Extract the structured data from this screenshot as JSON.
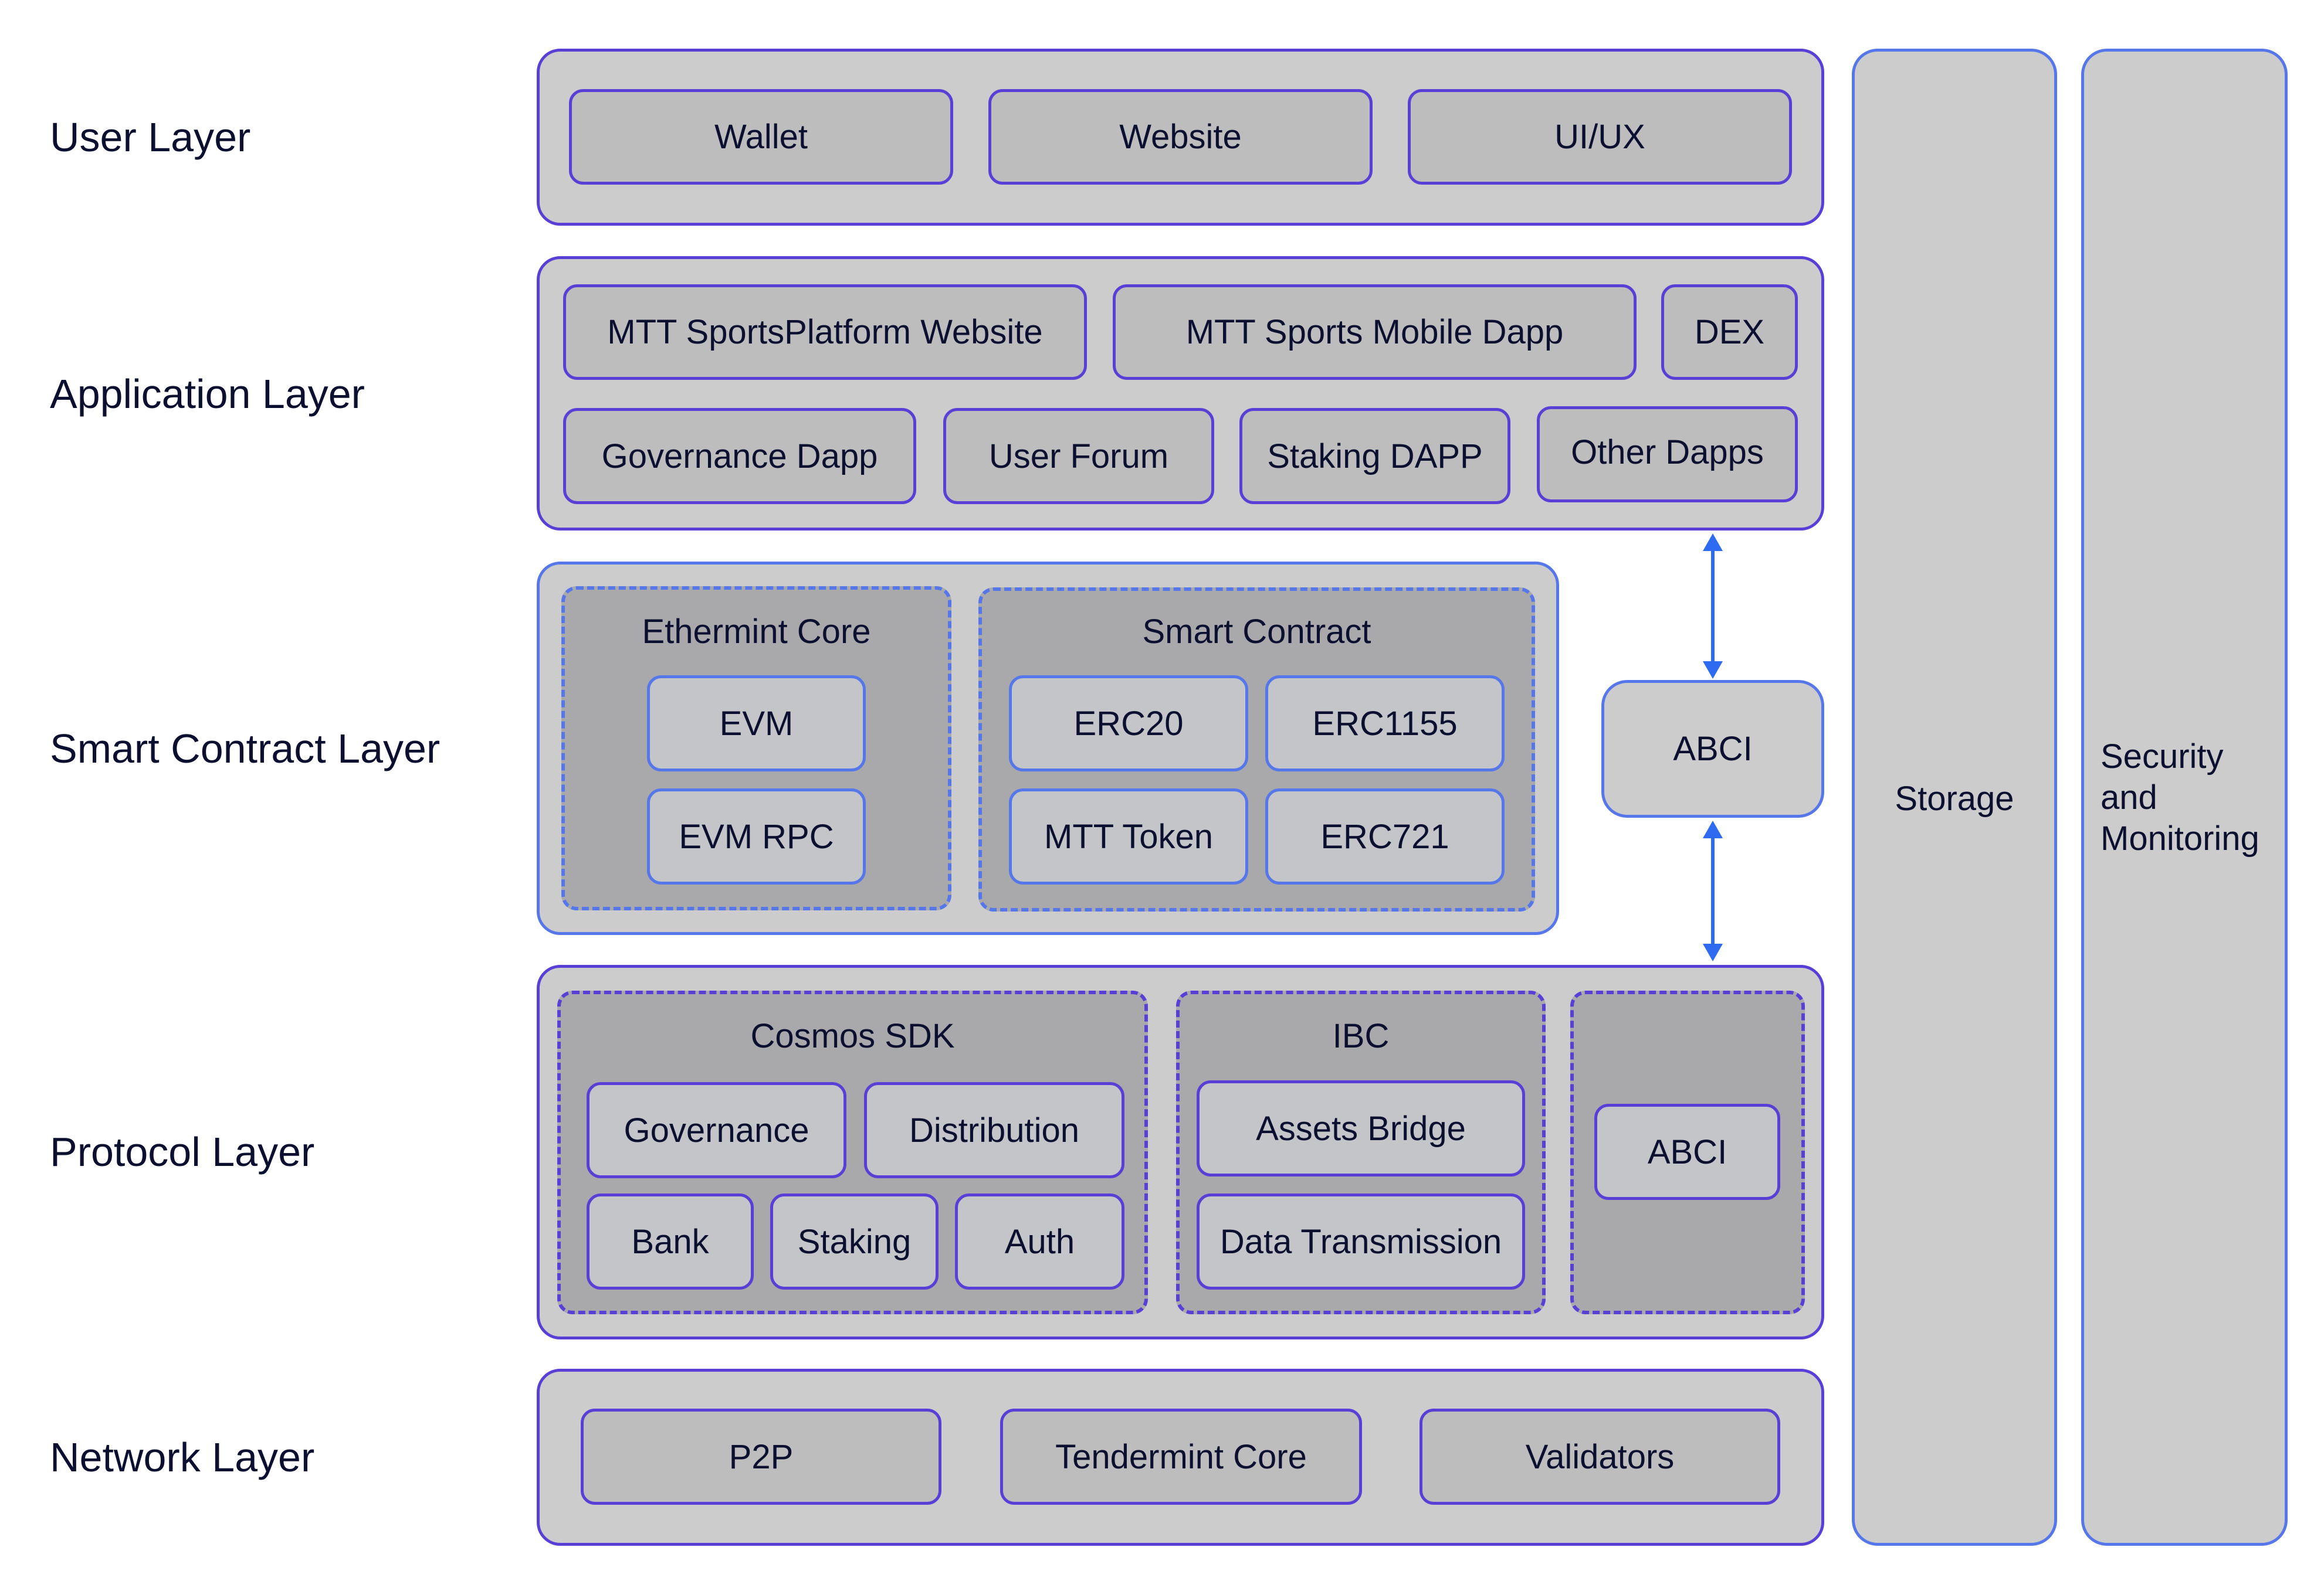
{
  "layers": {
    "user": {
      "label": "User Layer",
      "items": [
        "Wallet",
        "Website",
        "UI/UX"
      ]
    },
    "application": {
      "label": "Application Layer",
      "row1": [
        "MTT SportsPlatform Website",
        "MTT Sports Mobile Dapp",
        "DEX"
      ],
      "row2": [
        "Governance Dapp",
        "User Forum",
        "Staking DAPP",
        "Other Dapps"
      ]
    },
    "smart_contract": {
      "label": "Smart Contract Layer",
      "ethermint": {
        "title": "Ethermint Core",
        "items": [
          "EVM",
          "EVM RPC"
        ]
      },
      "contracts": {
        "title": "Smart Contract",
        "items": [
          "ERC20",
          "ERC1155",
          "MTT Token",
          "ERC721"
        ]
      },
      "abci": "ABCI"
    },
    "protocol": {
      "label": "Protocol Layer",
      "cosmos": {
        "title": "Cosmos SDK",
        "row1": [
          "Governance",
          "Distribution"
        ],
        "row2": [
          "Bank",
          "Staking",
          "Auth"
        ]
      },
      "ibc": {
        "title": "IBC",
        "items": [
          "Assets Bridge",
          "Data Transmission"
        ]
      },
      "abci": "ABCI"
    },
    "network": {
      "label": "Network Layer",
      "items": [
        "P2P",
        "Tendermint Core",
        "Validators"
      ]
    }
  },
  "side_columns": {
    "storage": "Storage",
    "security": [
      "Security",
      "and",
      "Monitoring"
    ]
  },
  "colors": {
    "container_fill": "#cccccc",
    "box_fill": "#bdbdbe",
    "group_fill": "#a9a9ac",
    "purple_border": "#5a3fd6",
    "blue_border": "#5677ea",
    "arrow": "#2f6bf0",
    "text": "#0b1030"
  }
}
